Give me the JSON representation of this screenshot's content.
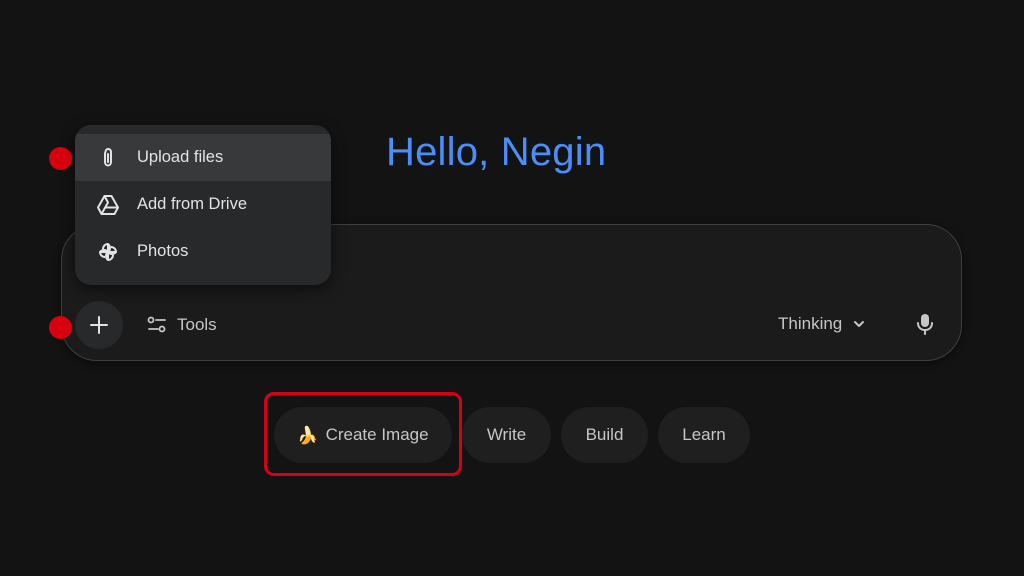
{
  "greeting": "Hello, Negin",
  "upload_menu": {
    "items": [
      {
        "label": "Upload files",
        "icon": "paperclip-icon",
        "active": true
      },
      {
        "label": "Add from Drive",
        "icon": "drive-icon",
        "active": false
      },
      {
        "label": "Photos",
        "icon": "photos-icon",
        "active": false
      }
    ]
  },
  "composer": {
    "add_icon": "plus-icon",
    "tools_label": "Tools",
    "model_label": "Thinking",
    "mic_icon": "mic-icon"
  },
  "suggestions": [
    {
      "label": "Create Image",
      "icon": "banana-icon",
      "highlighted": true
    },
    {
      "label": "Write"
    },
    {
      "label": "Build"
    },
    {
      "label": "Learn"
    }
  ],
  "colors": {
    "background": "#131314",
    "greeting": "#4c8df6",
    "annotation_red": "#d7000f"
  }
}
